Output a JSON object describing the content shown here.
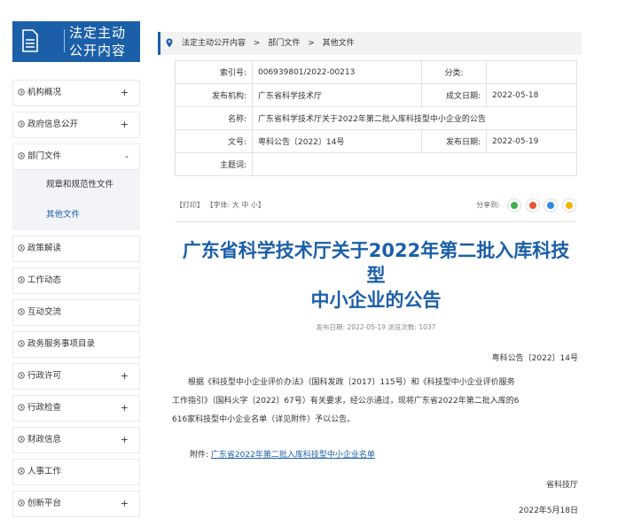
{
  "sidebar": {
    "header_line1": "法定主动",
    "header_line2": "公开内容",
    "items": [
      {
        "label": "机构概况",
        "toggle": "+"
      },
      {
        "label": "政府信息公开",
        "toggle": "+"
      },
      {
        "label": "部门文件",
        "toggle": "-"
      },
      {
        "label": "政策解读",
        "toggle": ""
      },
      {
        "label": "工作动态",
        "toggle": ""
      },
      {
        "label": "互动交流",
        "toggle": ""
      },
      {
        "label": "政务服务事项目录",
        "toggle": ""
      },
      {
        "label": "行政许可",
        "toggle": "+"
      },
      {
        "label": "行政检查",
        "toggle": "+"
      },
      {
        "label": "财政信息",
        "toggle": "+"
      },
      {
        "label": "人事工作",
        "toggle": ""
      },
      {
        "label": "创新平台",
        "toggle": "+"
      }
    ],
    "sub_items": [
      {
        "label": "规章和规范性文件"
      },
      {
        "label": "其他文件"
      }
    ]
  },
  "breadcrumb": {
    "items": [
      "法定主动公开内容",
      "部门文件",
      "其他文件"
    ],
    "separator": ">"
  },
  "meta": {
    "index_label": "索引号:",
    "index_value": "006939801/2022-00213",
    "category_label": "分类:",
    "category_value": "",
    "publisher_label": "发布机构:",
    "publisher_value": "广东省科学技术厅",
    "written_label": "成文日期:",
    "written_value": "2022-05-18",
    "name_label": "名称:",
    "name_value": "广东省科学技术厅关于2022年第二批入库科技型中小企业的公告",
    "docno_label": "文号:",
    "docno_value": "粤科公告〔2022〕14号",
    "published_label": "发布日期:",
    "published_value": "2022-05-19",
    "subject_label": "主题词:",
    "subject_value": ""
  },
  "tools": {
    "print": "【打印】",
    "font": "【字体:",
    "font_large": "大",
    "font_medium": "中",
    "font_small": "小】",
    "share_label": "分享到:"
  },
  "article": {
    "title_line1": "广东省科学技术厅关于2022年第二批入库科技型",
    "title_line2": "中小企业的公告",
    "pubinfo": "发布日期: 2022-05-19 浏览次数: 1037",
    "docno": "粤科公告〔2022〕14号",
    "body_line1": "根据《科技型中小企业评价办法》（国科发政〔2017〕115号）和《科技型中小企业评价服务",
    "body_line2": "工作指引》（国科火字〔2022〕67号）有关要求，经公示通过，现将广东省2022年第二批入库的6",
    "body_line3": "616家科技型中小企业名单（详见附件）予以公告。",
    "attach_label": "附件:",
    "attach_link": "广东省2022年第二批入库科技型中小企业名单",
    "sign_org": "省科技厅",
    "sign_date": "2022年5月18日"
  },
  "colors": {
    "accent": "#1b5fa8",
    "wechat": "#3db24b",
    "weibo": "#e8542c",
    "qq": "#2a8ce8",
    "qzone": "#f5b400"
  }
}
